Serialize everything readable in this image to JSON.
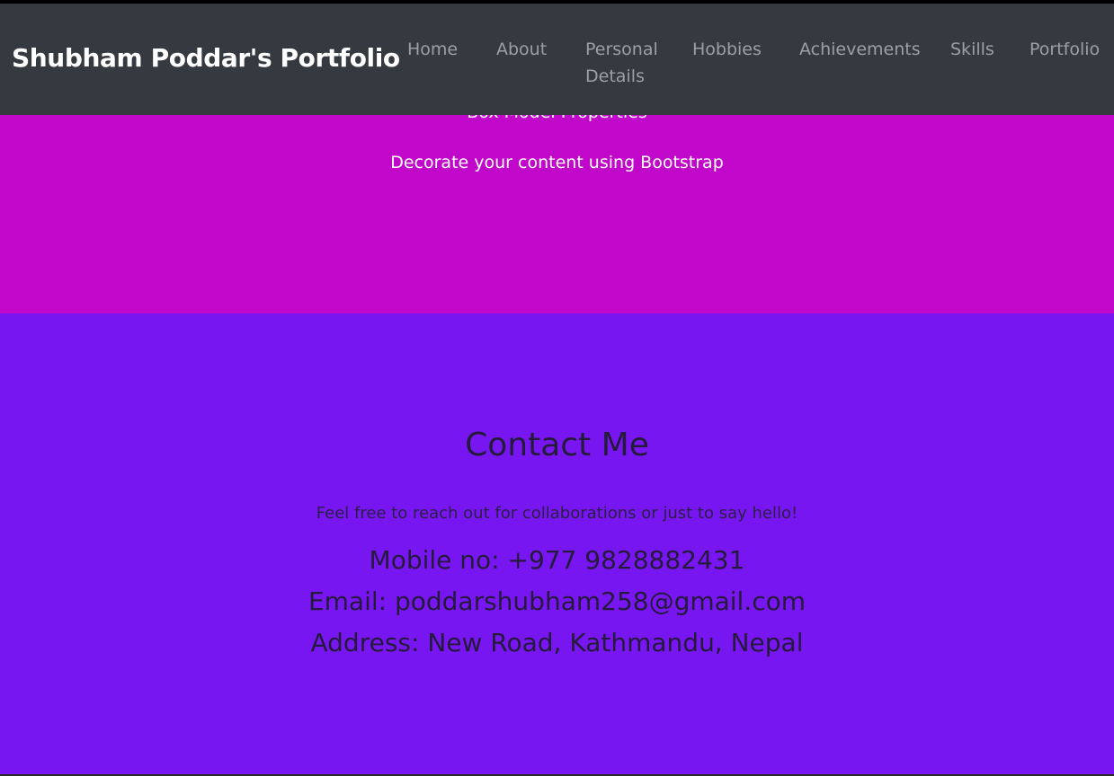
{
  "navbar": {
    "brand": "Shubham Poddar's Portfolio",
    "links": [
      "Home",
      "About",
      "Personal Details",
      "Hobbies",
      "Achievements",
      "Skills",
      "Portfolio"
    ]
  },
  "magenta_section": {
    "partial_text": "Box Model Properties",
    "text": "Decorate your content using Bootstrap"
  },
  "contact": {
    "title": "Contact Me",
    "subtitle": "Feel free to reach out for collaborations or just to say hello!",
    "mobile": "Mobile no: +977 9828882431",
    "email": "Email: poddarshubham258@gmail.com",
    "address": "Address: New Road, Kathmandu, Nepal"
  },
  "colors": {
    "navbar_bg": "#343a40",
    "magenta_bg": "#c107c9",
    "purple_bg": "#7816f2",
    "contact_text": "#241a3a"
  }
}
